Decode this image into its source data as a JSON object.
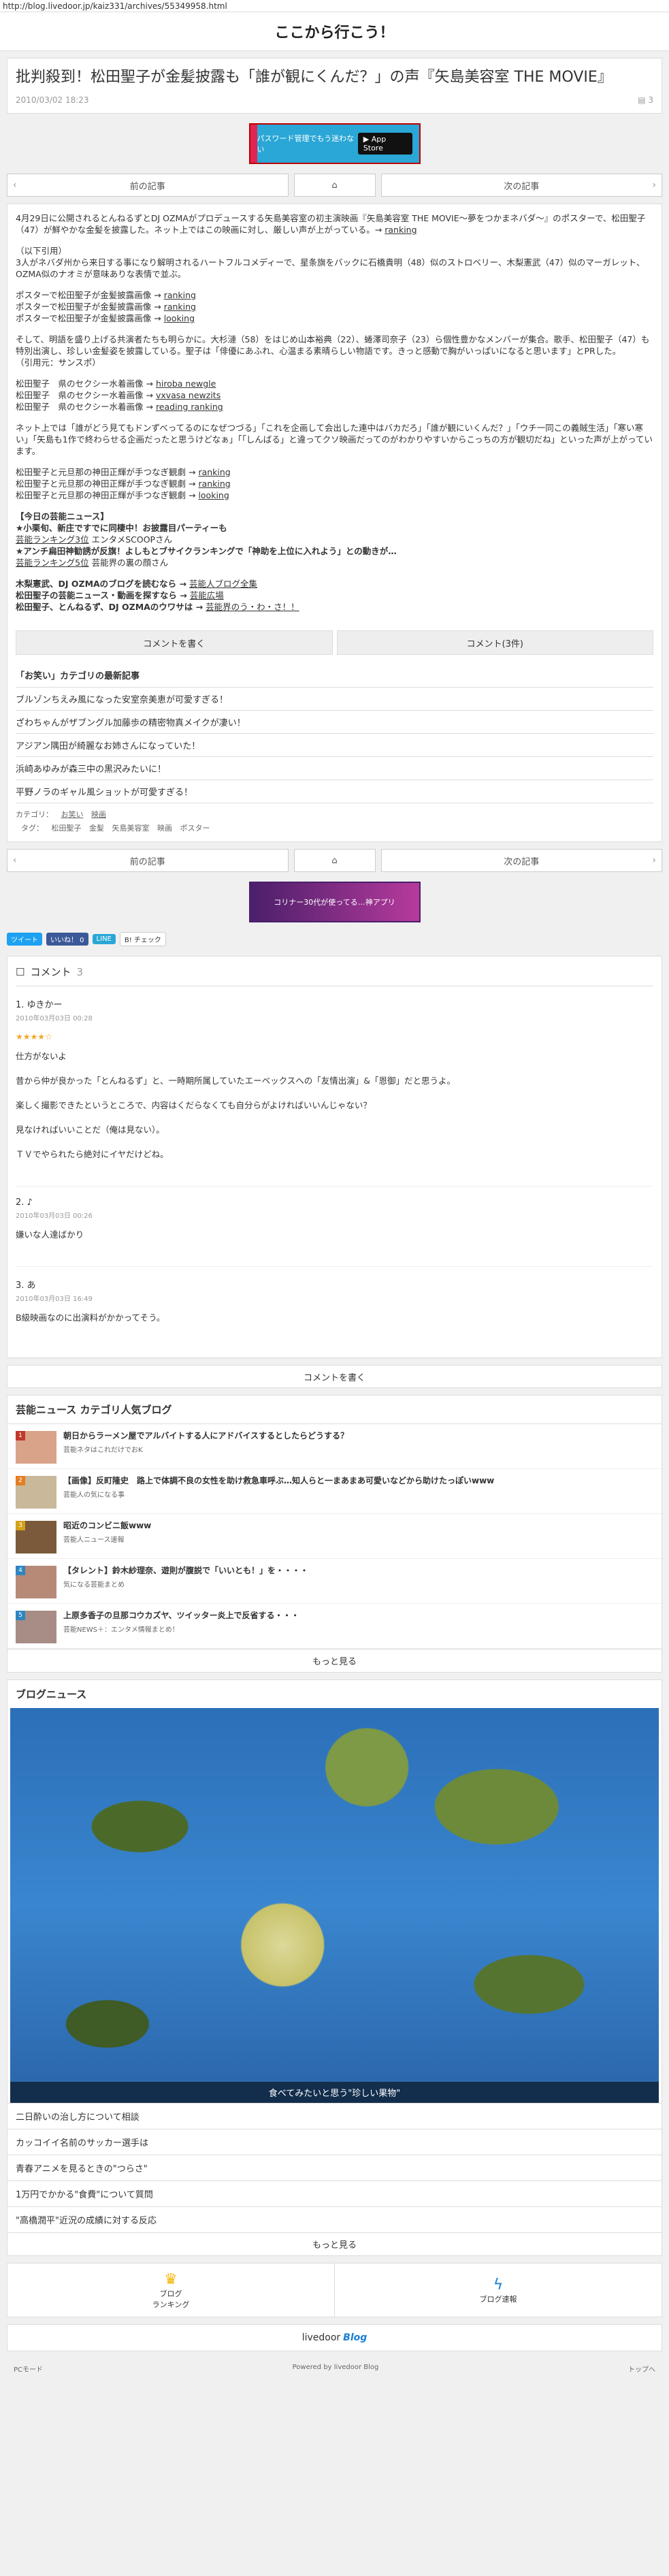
{
  "url": "http://blog.livedoor.jp/kaiz331/archives/55349958.html",
  "site_title": "ここから行こう！",
  "article": {
    "title": "批判殺到！松田聖子が金髪披露も「誰が観にくんだ？」の声『矢島美容室 THE MOVIE』",
    "date": "2010/03/02 18:23",
    "comment_count": "3"
  },
  "ad_top": {
    "text": "パスワード管理でもう迷わない",
    "store": "App Store"
  },
  "pager": {
    "prev": "前の記事",
    "next": "次の記事"
  },
  "body": {
    "p1": "4月29日に公開されるとんねるずとDJ OZMAがプロデュースする矢島美容室の初主演映画『矢島美容室 THE MOVIE〜夢をつかまネバダ〜』のポスターで、松田聖子（47）が鮮やかな金髪を披露した。ネット上ではこの映画に対し、厳しい声が上がっている。→",
    "p1_link": "ranking",
    "p2a": "（以下引用）",
    "p2b": "3人がネバダ州から来日する事になり解明されるハートフルコメディーで、星条旗をバックに石橋貴明（48）似のストロベリー、木梨憲武（47）似のマーガレット、OZMA似のナオミが意味ありな表情で並ぶ。",
    "links1": [
      {
        "text": "ポスターで松田聖子が金髪披露画像 →",
        "link": "ranking"
      },
      {
        "text": "ポスターで松田聖子が金髪披露画像 →",
        "link": "ranking"
      },
      {
        "text": "ポスターで松田聖子が金髪披露画像 →",
        "link": "looking"
      }
    ],
    "p3": "そして、明語を盛り上げる共演者たちも明らかに。大杉漣（58）をはじめ山本裕典（22）、蜷澤司奈子（23）ら個性豊かなメンバーが集合。歌手、松田聖子（47）も特別出演し、珍しい金髪姿を披露している。聖子は「俳優にあふれ、心温まる素晴らしい物語です。きっと感動で胸がいっぱいになると思います」とPRした。",
    "p3_src": "（引用元：サンスポ）",
    "links2": [
      {
        "text": "松田聖子　県のセクシー水着画像 →",
        "link": "hiroba newgle"
      },
      {
        "text": "松田聖子　県のセクシー水着画像 →",
        "link": "vxvasa newzits"
      },
      {
        "text": "松田聖子　県のセクシー水着画像 →",
        "link": "reading ranking"
      }
    ],
    "p4": "ネット上では「誰がどう見てもドンずべってるのになぜつづる」「これを企画して会出した連中はバカだろ」「誰が観にいくんだ？」「ウチ一同この義賊生活」「寒い寒い」「矢島も1作で終わらせる企画だったと思うけどなぁ」「「しんばる」と違ってクソ映画だってのがわかりやすいからこっちの方が観切だね」といった声が上がっています。",
    "links3": [
      {
        "text": "松田聖子と元旦那の神田正輝が手つなぎ観劇 →",
        "link": "ranking"
      },
      {
        "text": "松田聖子と元旦那の神田正輝が手つなぎ観劇 →",
        "link": "ranking"
      },
      {
        "text": "松田聖子と元旦那の神田正輝が手つなぎ観劇 →",
        "link": "looking"
      }
    ],
    "news_head": "【今日の芸能ニュース】",
    "news1": "★小栗旬、新庄ですでに同棲中！お披露目パーティーも",
    "news1_link": "芸能ランキング3位",
    "news1_src": "エンタメSCOOPさん",
    "news2": "★アンチ扁田神勧誘が反旗！よしもとブサイクランキングで「神助を上位に入れよう」との動きが…",
    "news2_link": "芸能ランキング5位",
    "news2_src": "芸能界の裏の顔さん",
    "tail1a": "木梨憲武、DJ OZMAのブログを読むなら →",
    "tail1b": "芸能人ブログ全集",
    "tail2a": "松田聖子の芸能ニュース・動画を探すなら →",
    "tail2b": "芸能広場",
    "tail3a": "松田聖子、とんねるず、DJ OZMAのウワサは →",
    "tail3b": "芸能界のう・わ・さ！！"
  },
  "comment_buttons": {
    "write": "コメントを書く",
    "view": "コメント(3件)"
  },
  "related": {
    "head": "「お笑い」カテゴリの最新記事",
    "items": [
      "ブルゾンちえみ風になった安室奈美恵が可愛すぎる！",
      "ざわちゃんがザブングル加藤歩の精密物真メイクが凄い！",
      "アジアン隅田が綺麗なお姉さんになっていた！",
      "浜崎あゆみが森三中の黒沢みたいに！",
      "平野ノラのギャル風ショットが可愛すぎる！"
    ]
  },
  "category": {
    "label": "カテゴリ：",
    "values": [
      "お笑い",
      "映画"
    ]
  },
  "tags": {
    "label": "タグ：",
    "values": [
      "松田聖子",
      "金髪",
      "矢島美容室",
      "映画",
      "ポスター"
    ]
  },
  "ad_bottom": {
    "text": "コリナー30代が使ってる…神アプリ"
  },
  "social": {
    "tweet": "ツイート",
    "like": "いいね！ 0",
    "line": "LINE",
    "hatena": "B! チェック"
  },
  "comments": {
    "title": "コメント",
    "count": "3",
    "items": [
      {
        "name": "1. ゆきかー",
        "date": "2010年03月03日 00:28",
        "stars": "★★★★☆",
        "lines": [
          "仕方がないよ",
          "昔から仲が良かった「とんねるず」と、一時期所属していたエーベックスへの「友情出演」&「恩御」だと思うよ。",
          "楽しく撮影できたというところで、内容はくだらなくても自分らがよければいいんじゃない？",
          "見なければいいことだ（俺は見ない）。",
          "ＴＶでやられたら絶対にイヤだけどね。"
        ]
      },
      {
        "name": "2. ♪",
        "date": "2010年03月03日 00:26",
        "stars": "",
        "lines": [
          "嫌いな人達ばかり"
        ]
      },
      {
        "name": "3. あ",
        "date": "2010年03月03日 16:49",
        "stars": "",
        "lines": [
          "B級映画なのに出演料がかかってそう。"
        ]
      }
    ]
  },
  "write_comment": "コメントを書く",
  "ranking": {
    "head": "芸能ニュース カテゴリ人気ブログ",
    "items": [
      {
        "num": "1",
        "title": "朝日からラーメン屋でアルバイトする人にアドバイスするとしたらどうする？",
        "source": "芸能ネタはこれだけでおK",
        "color": "#c0392b"
      },
      {
        "num": "2",
        "title": "【画像】反町隆史　路上で体調不良の女性を助け救急車呼ぶ…知人らと一まあまあ可愛いなどから助けたっぽいwww",
        "source": "芸能人の気になる事",
        "color": "#e67e22"
      },
      {
        "num": "3",
        "title": "昭近のコンビニ飯www",
        "source": "芸能人ニュース速報",
        "color": "#d4a017"
      },
      {
        "num": "4",
        "title": "【タレント】鈴木紗理奈、遊則が腹説で「いいとも！」を・・・・",
        "source": "気になる芸能まとめ",
        "color": "#2e86c1"
      },
      {
        "num": "5",
        "title": "上原多香子の旦那コウカズヤ、ツイッター炎上で反省する・・・",
        "source": "芸能NEWS＋：エンタメ情報まとめ！",
        "color": "#2e86c1"
      }
    ],
    "more": "もっと見る"
  },
  "blog_news": {
    "head": "ブログニュース",
    "caption": "食べてみたいと思う\"珍しい果物\"",
    "items": [
      "二日酔いの治し方について相談",
      "カッコイイ名前のサッカー選手は",
      "青春アニメを見るときの\"つらさ\"",
      "1万円でかかる\"食費\"について質問",
      "\"高橋潤平\"近況の成績に対する反応"
    ],
    "more": "もっと見る"
  },
  "bottom_nav": {
    "ranking": "ブログ\nランキング",
    "speed": "ブログ速報"
  },
  "logo": {
    "livedoor": "livedoor",
    "blog": "Blog"
  },
  "footer": {
    "pc": "PCモード",
    "powered": "Powered by livedoor Blog",
    "top": "トップへ"
  }
}
